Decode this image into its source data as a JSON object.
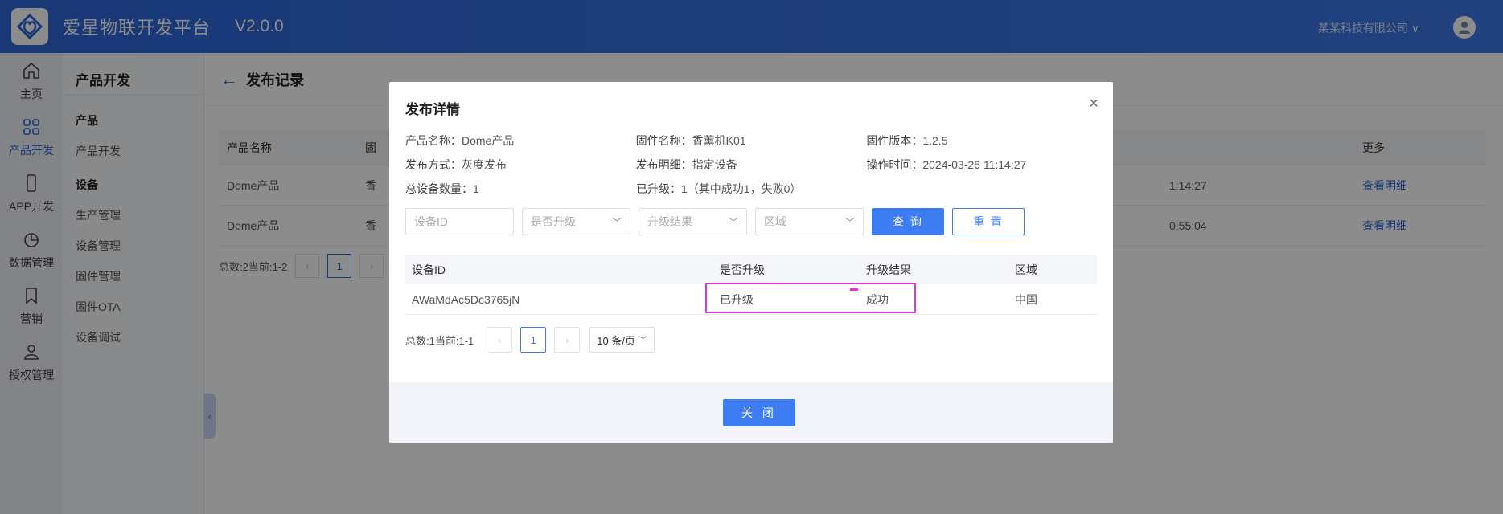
{
  "header": {
    "app_title": "爱星物联开发平台",
    "version": "V2.0.0",
    "company": "某某科技有限公司",
    "brand_color": "#2f66d8"
  },
  "nav": {
    "items": [
      {
        "label": "主页",
        "icon": "home-icon"
      },
      {
        "label": "产品开发",
        "icon": "grid-icon"
      },
      {
        "label": "APP开发",
        "icon": "phone-icon"
      },
      {
        "label": "数据管理",
        "icon": "pie-chart-icon"
      },
      {
        "label": "营销",
        "icon": "bookmark-icon"
      },
      {
        "label": "授权管理",
        "icon": "user-icon"
      }
    ],
    "active": "产品开发"
  },
  "subnav": {
    "title": "产品开发",
    "group1": "产品",
    "group1_items": [
      "产品开发"
    ],
    "group2": "设备",
    "group2_items": [
      "生产管理",
      "设备管理",
      "固件管理",
      "固件OTA",
      "设备调试"
    ]
  },
  "page": {
    "title": "发布记录",
    "table": {
      "headers": [
        "产品名称",
        "固",
        "",
        "更多"
      ],
      "rows": [
        {
          "product": "Dome产品",
          "firmware": "香",
          "time": "1:14:27",
          "action": "查看明细"
        },
        {
          "product": "Dome产品",
          "firmware": "香",
          "time": "0:55:04",
          "action": "查看明细"
        }
      ]
    },
    "pager": {
      "summary": "总数:2当前:1-2",
      "prev": "‹",
      "current": "1",
      "next": "›"
    }
  },
  "modal": {
    "title": "发布详情",
    "close_icon": "×",
    "info": [
      [
        {
          "key": "产品名称：",
          "value": "Dome产品"
        },
        {
          "key": "固件名称：",
          "value": "香薰机K01"
        },
        {
          "key": "固件版本：",
          "value": "1.2.5"
        }
      ],
      [
        {
          "key": "发布方式：",
          "value": "灰度发布"
        },
        {
          "key": "发布明细：",
          "value": "指定设备"
        },
        {
          "key": "操作时间：",
          "value": "2024-03-26 11:14:27"
        }
      ],
      [
        {
          "key": "总设备数量：",
          "value": "1"
        },
        {
          "key": "已升级：",
          "value": "1（其中成功1，失败0）"
        }
      ]
    ],
    "filters": {
      "device_id_placeholder": "设备ID",
      "upgraded_placeholder": "是否升级",
      "result_placeholder": "升级结果",
      "region_placeholder": "区域",
      "query_label": "查 询",
      "reset_label": "重 置"
    },
    "table": {
      "headers": [
        "设备ID",
        "是否升级",
        "升级结果",
        "区域"
      ],
      "rows": [
        [
          "AWaMdAc5Dc3765jN",
          "已升级",
          "成功",
          "中国"
        ]
      ]
    },
    "pager": {
      "summary": "总数:1当前:1-1",
      "prev": "‹",
      "current": "1",
      "next": "›",
      "page_size": "10 条/页"
    },
    "footer_close": "关 闭"
  }
}
